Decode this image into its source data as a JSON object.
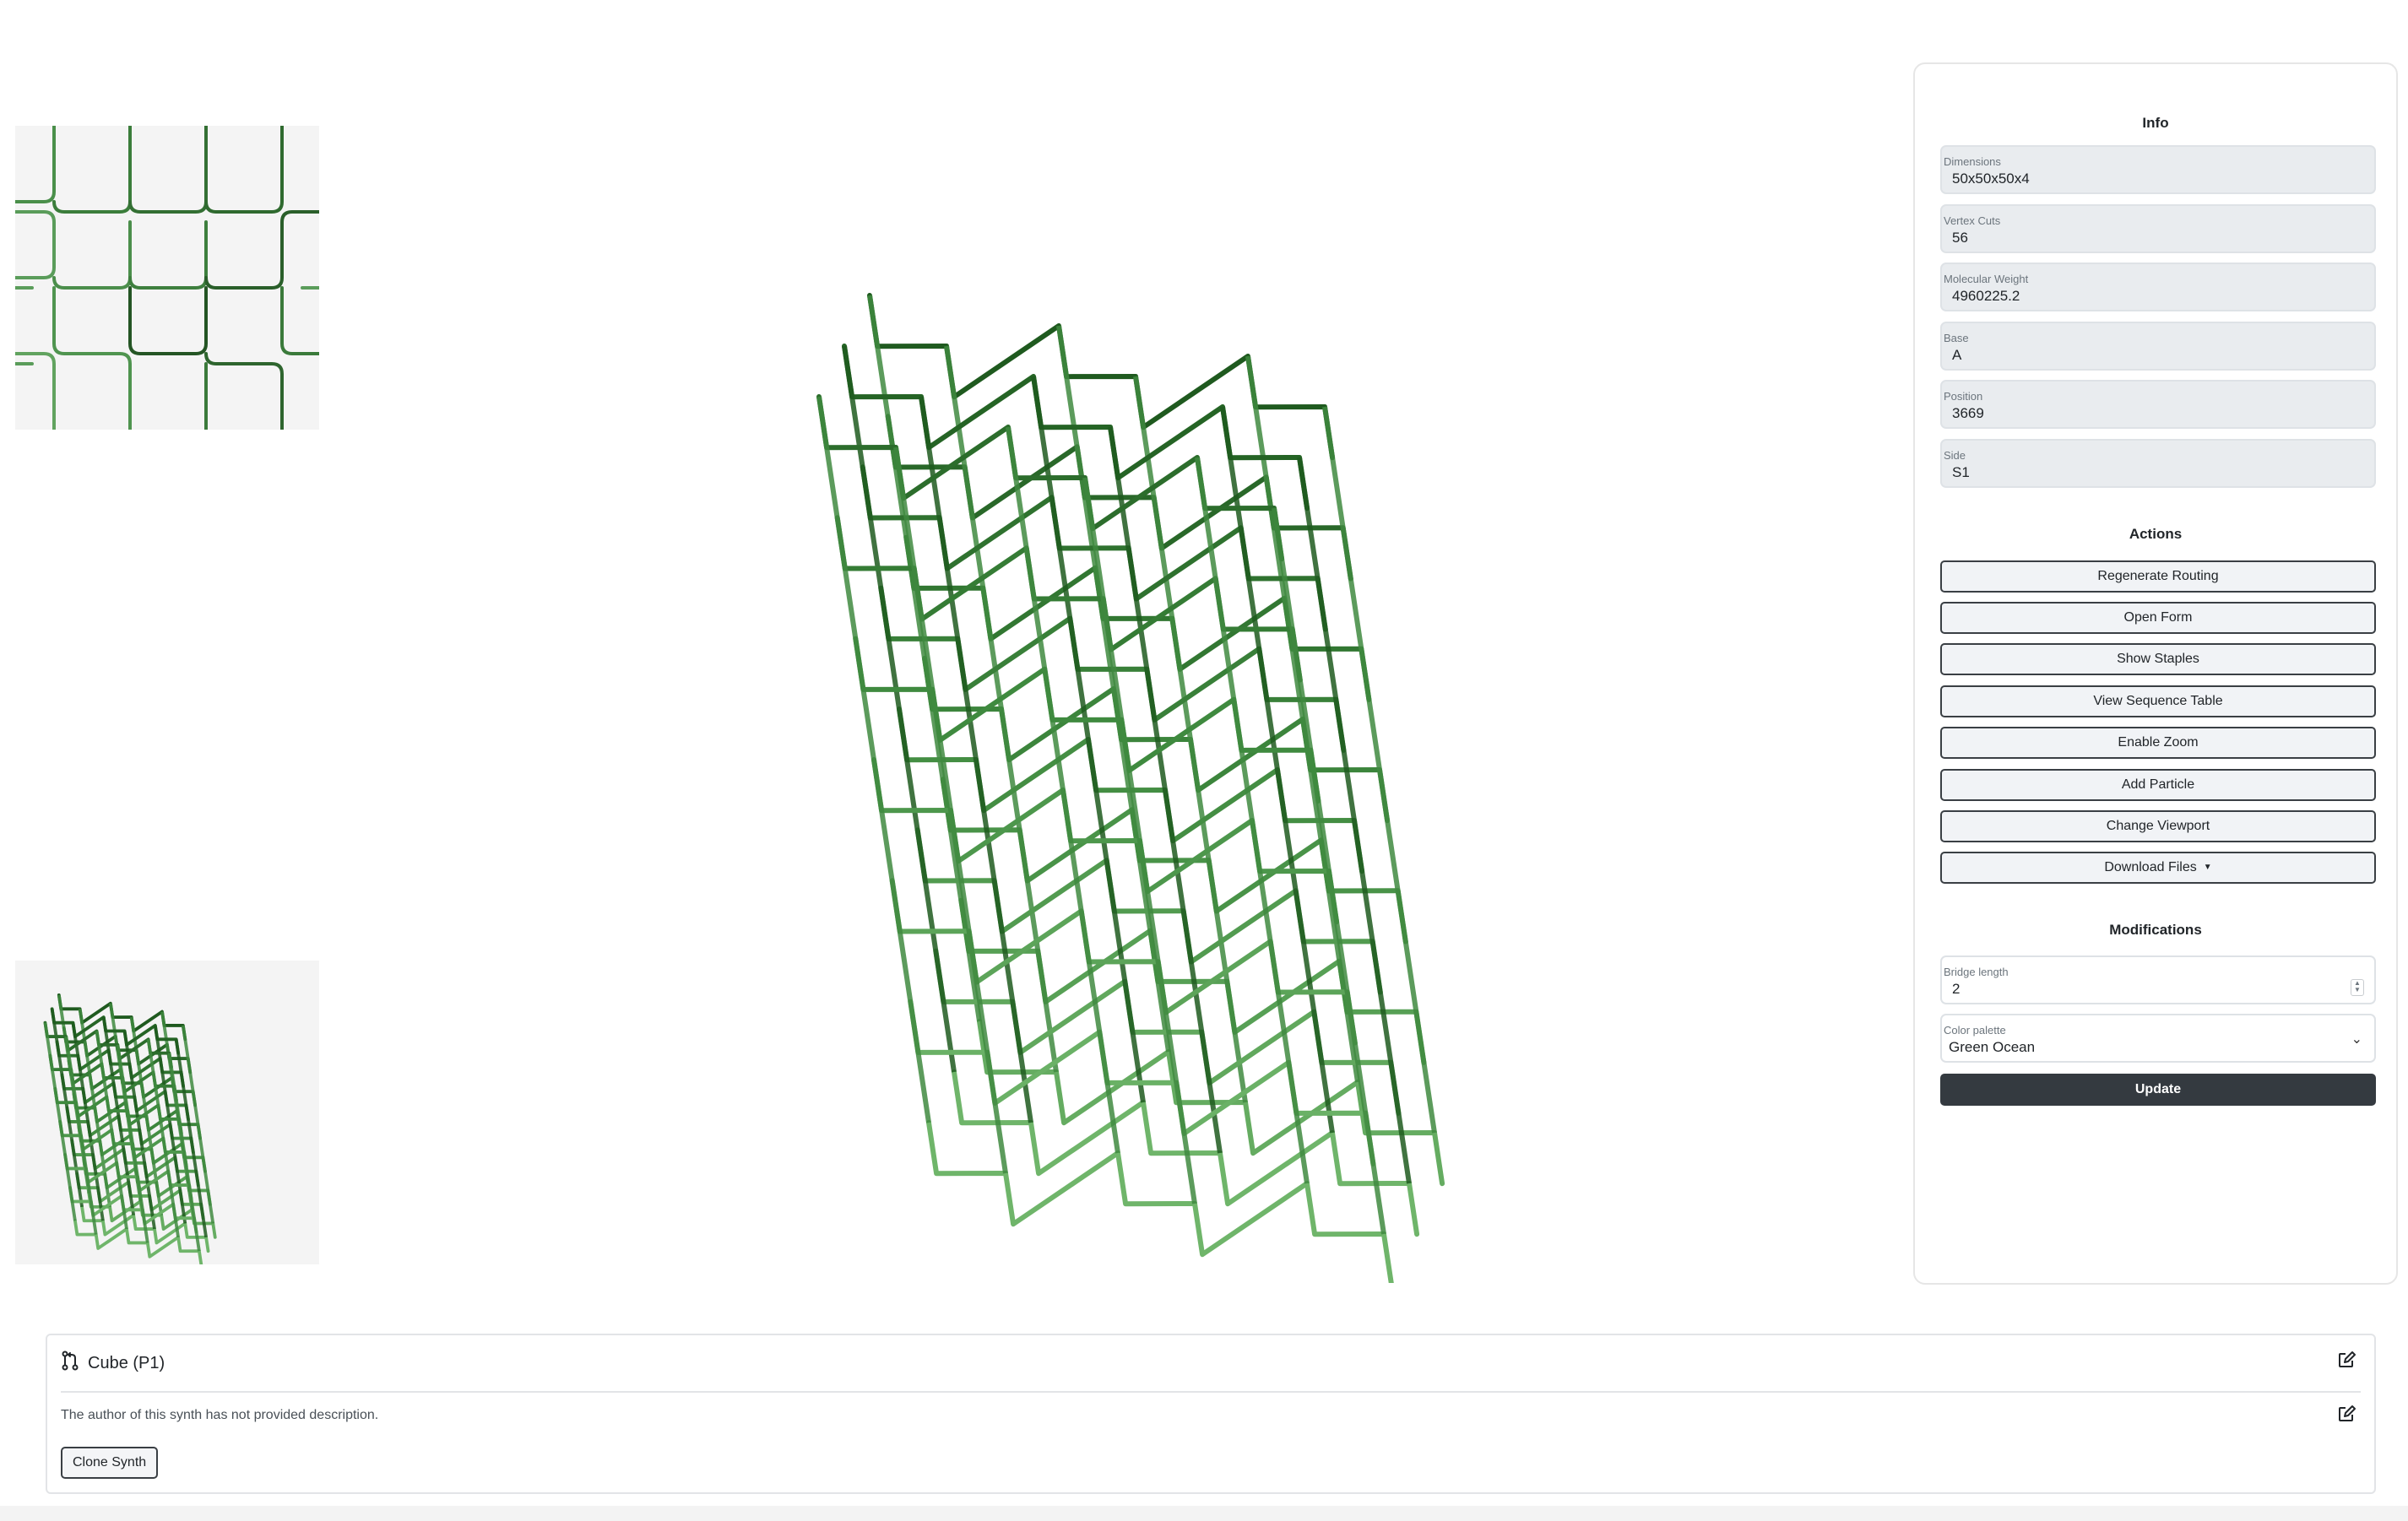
{
  "colors": {
    "strand_dark": "#1f5a1f",
    "strand_mid": "#3f8a3f",
    "strand_light": "#6fb56a",
    "button_dark": "#343a40"
  },
  "info": {
    "title": "Info",
    "fields": [
      {
        "label": "Dimensions",
        "value": "50x50x50x4"
      },
      {
        "label": "Vertex Cuts",
        "value": "56"
      },
      {
        "label": "Molecular Weight",
        "value": "4960225.2"
      },
      {
        "label": "Base",
        "value": "A"
      },
      {
        "label": "Position",
        "value": "3669"
      },
      {
        "label": "Side",
        "value": "S1"
      }
    ]
  },
  "actions": {
    "title": "Actions",
    "buttons": [
      "Regenerate Routing",
      "Open Form",
      "Show Staples",
      "View Sequence Table",
      "Enable Zoom",
      "Add Particle",
      "Change Viewport",
      "Download Files"
    ]
  },
  "modifications": {
    "title": "Modifications",
    "bridge_label": "Bridge length",
    "bridge_value": "2",
    "palette_label": "Color palette",
    "palette_value": "Green Ocean",
    "update_label": "Update"
  },
  "synth": {
    "title": "Cube (P1)",
    "description": "The author of this synth has not provided description.",
    "clone_label": "Clone Synth"
  },
  "icons": [
    "git-branch-icon",
    "edit-icon",
    "chevron-down-icon",
    "caret-down-icon"
  ]
}
